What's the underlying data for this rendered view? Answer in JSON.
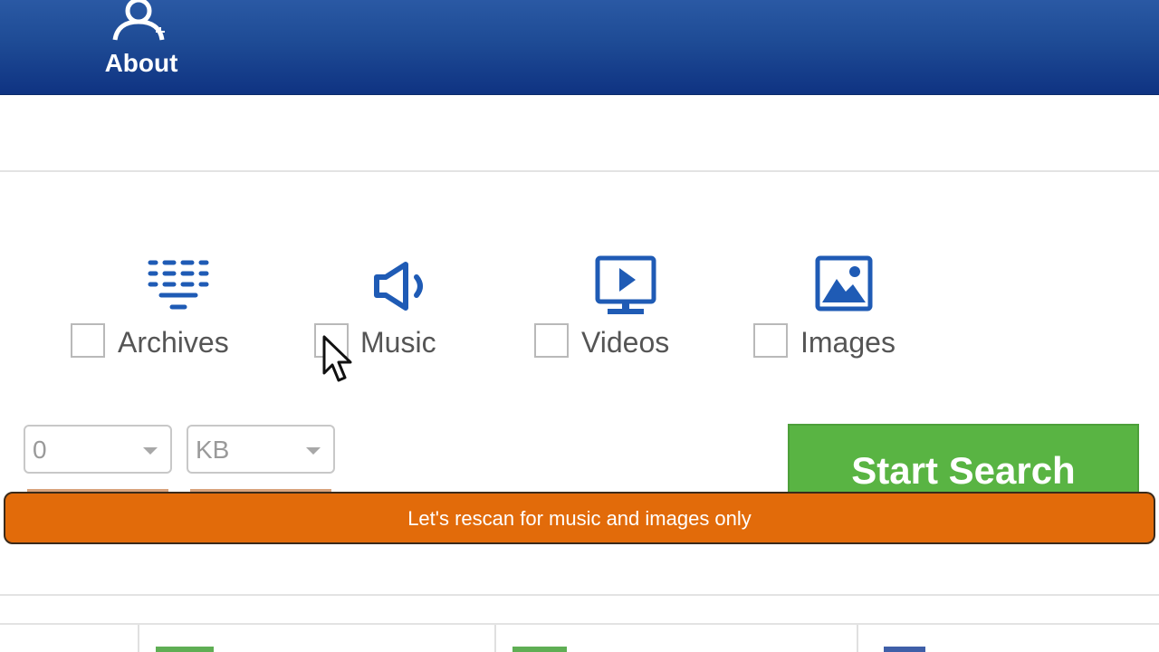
{
  "header": {
    "about_label": "About",
    "about_icon": "user-icon"
  },
  "file_types": [
    {
      "label": "Archives",
      "icon": "archives-icon",
      "checked": false
    },
    {
      "label": "Music",
      "icon": "speaker-icon",
      "checked": false
    },
    {
      "label": "Videos",
      "icon": "video-monitor-icon",
      "checked": false
    },
    {
      "label": "Images",
      "icon": "image-icon",
      "checked": false
    }
  ],
  "size_filter": {
    "value": "0",
    "unit": "KB"
  },
  "start_search_label": "Start Search",
  "caption": "Let's rescan for music and images only",
  "colors": {
    "header": "#1e4b95",
    "accent_blue": "#1f5bb5",
    "start_button": "#59b443",
    "caption": "#e26b0a"
  }
}
